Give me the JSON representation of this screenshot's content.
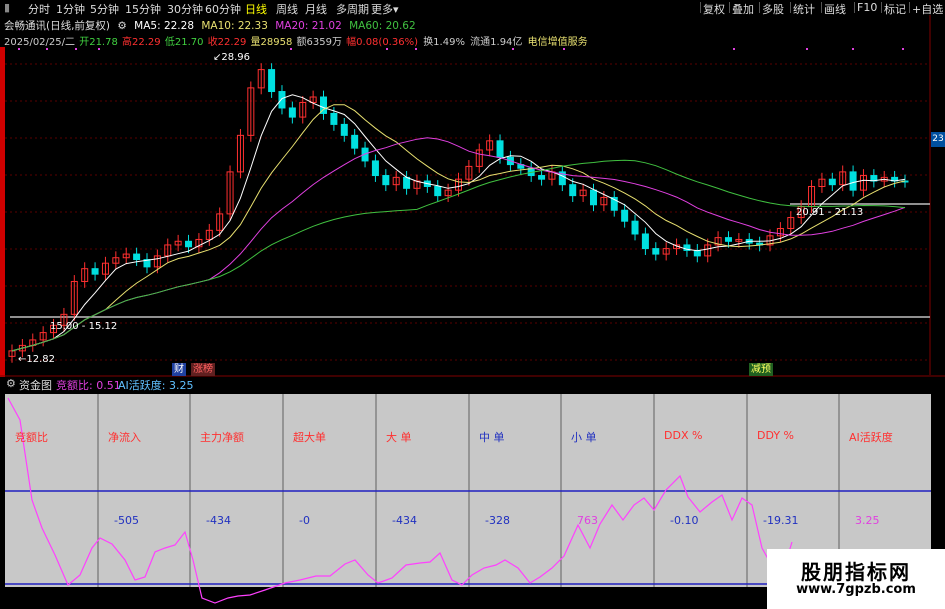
{
  "toolbar": {
    "left": [
      "分时",
      "1分钟",
      "5分钟",
      "15分钟",
      "30分钟",
      "60分钟",
      "日线",
      "周线",
      "月线",
      "多周期",
      "更多▾"
    ],
    "active_index": 6,
    "right": [
      "复权",
      "叠加",
      "多股",
      "统计",
      "画线",
      "F10",
      "标记",
      "+自选"
    ]
  },
  "ma_line": {
    "stock": "会畅通讯(日线,前复权)",
    "ma5": "MA5: 22.28",
    "ma10": "MA10: 22.33",
    "ma20": "MA20: 21.02",
    "ma60": "MA60: 20.62"
  },
  "quote_line": {
    "date": "2025/02/25/二",
    "open": "开21.78",
    "high": "高22.29",
    "low": "低21.70",
    "close": "收22.29",
    "volume": "量28958",
    "amount": "额6359万",
    "change": "幅0.08(0.36%)",
    "turnover": "换1.49%",
    "float": "流通1.94亿",
    "sector": "电信增值服务"
  },
  "annotations": {
    "high_price": "28.96",
    "low_price": "12.82",
    "support_range": "15.00 - 15.12",
    "resist_range": "20.91 - 21.13",
    "axis_tag": "23"
  },
  "event_tags": {
    "cai": "财",
    "zhang": "涨榜",
    "jian": "减预"
  },
  "sub_chart": {
    "title": "资金图",
    "ratio_label": "竞额比: 0.51",
    "ai_label": "AI活跃度: 3.25"
  },
  "table": {
    "headers": [
      "竞额比",
      "净流入",
      "主力净额",
      "超大单",
      "大 单",
      "中 单",
      "小 单",
      "DDX %",
      "DDY %",
      "AI活跃度"
    ],
    "values": [
      "",
      "-505",
      "-434",
      "-0",
      "-434",
      "-328",
      "763",
      "-0.10",
      "-19.31",
      "3.25"
    ]
  },
  "watermark": {
    "title": "股朋指标网",
    "url": "www.7gpzb.com"
  },
  "colors": {
    "up": "#ff3030",
    "down": "#00e0e0",
    "ma5": "#ffffff",
    "ma10": "#e8e070",
    "ma20": "#e040e0",
    "ma60": "#40c040"
  }
}
